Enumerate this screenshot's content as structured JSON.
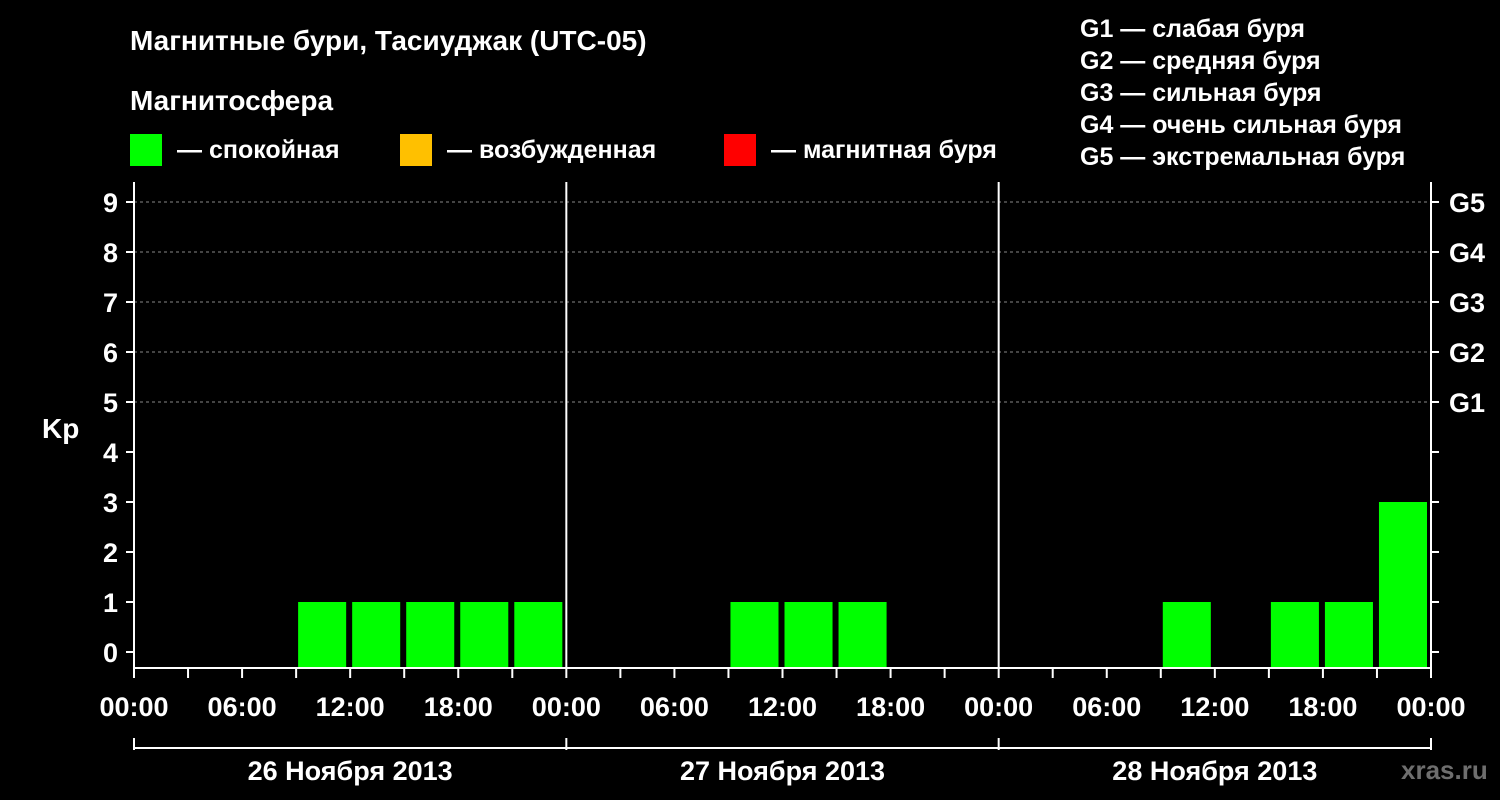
{
  "title": "Магнитные бури, Тасиуджак (UTC-05)",
  "legend_header": "Магнитосфера",
  "legend": [
    {
      "label": "— спокойная",
      "color": "#00ff00"
    },
    {
      "label": "— возбужденная",
      "color": "#ffc000"
    },
    {
      "label": "— магнитная буря",
      "color": "#ff0000"
    }
  ],
  "g_scale": [
    "G1 — слабая буря",
    "G2 — средняя буря",
    "G3 — сильная буря",
    "G4 — очень сильная буря",
    "G5 — экстремальная буря"
  ],
  "watermark": "xras.ru",
  "chart_data": {
    "type": "bar",
    "ylabel": "Kp",
    "ylim": [
      0,
      9
    ],
    "yticks": [
      "0",
      "1",
      "2",
      "3",
      "4",
      "5",
      "6",
      "7",
      "8",
      "9"
    ],
    "right_axis_labels": [
      {
        "kp": 5,
        "label": "G1"
      },
      {
        "kp": 6,
        "label": "G2"
      },
      {
        "kp": 7,
        "label": "G3"
      },
      {
        "kp": 8,
        "label": "G4"
      },
      {
        "kp": 9,
        "label": "G5"
      }
    ],
    "xtick_labels": [
      "00:00",
      "06:00",
      "12:00",
      "18:00",
      "00:00",
      "06:00",
      "12:00",
      "18:00",
      "00:00",
      "06:00",
      "12:00",
      "18:00",
      "00:00"
    ],
    "days": [
      "26 Ноября 2013",
      "27 Ноября 2013",
      "28 Ноября 2013"
    ],
    "grid": true,
    "categories": [
      "26 Ноября 2013 00:00",
      "26 Ноября 2013 03:00",
      "26 Ноября 2013 06:00",
      "26 Ноября 2013 09:00",
      "26 Ноября 2013 12:00",
      "26 Ноября 2013 15:00",
      "26 Ноября 2013 18:00",
      "26 Ноября 2013 21:00",
      "27 Ноября 2013 00:00",
      "27 Ноября 2013 03:00",
      "27 Ноября 2013 06:00",
      "27 Ноября 2013 09:00",
      "27 Ноября 2013 12:00",
      "27 Ноября 2013 15:00",
      "27 Ноября 2013 18:00",
      "27 Ноября 2013 21:00",
      "28 Ноября 2013 00:00",
      "28 Ноября 2013 03:00",
      "28 Ноября 2013 06:00",
      "28 Ноября 2013 09:00",
      "28 Ноября 2013 12:00",
      "28 Ноября 2013 15:00",
      "28 Ноября 2013 18:00",
      "28 Ноября 2013 21:00"
    ],
    "values": [
      0,
      0,
      0,
      1,
      1,
      1,
      1,
      1,
      0,
      0,
      0,
      1,
      1,
      1,
      0,
      0,
      0,
      0,
      0,
      1,
      0,
      1,
      1,
      3
    ],
    "bar_color": "#00ff00"
  }
}
